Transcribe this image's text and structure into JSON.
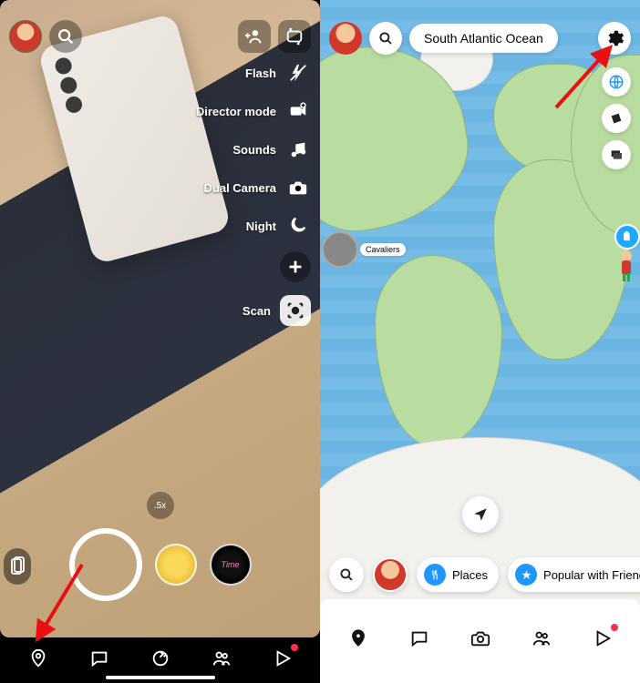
{
  "left": {
    "tools": {
      "flash": "Flash",
      "director": "Director mode",
      "sounds": "Sounds",
      "dual": "Dual Camera",
      "night": "Night",
      "scan": "Scan"
    },
    "zoom": ".5x"
  },
  "right": {
    "location": "South Atlantic Ocean",
    "stories": {
      "cavaliers": "Cavaliers"
    },
    "places": {
      "label": "Places",
      "popular": "Popular with Friends"
    }
  }
}
